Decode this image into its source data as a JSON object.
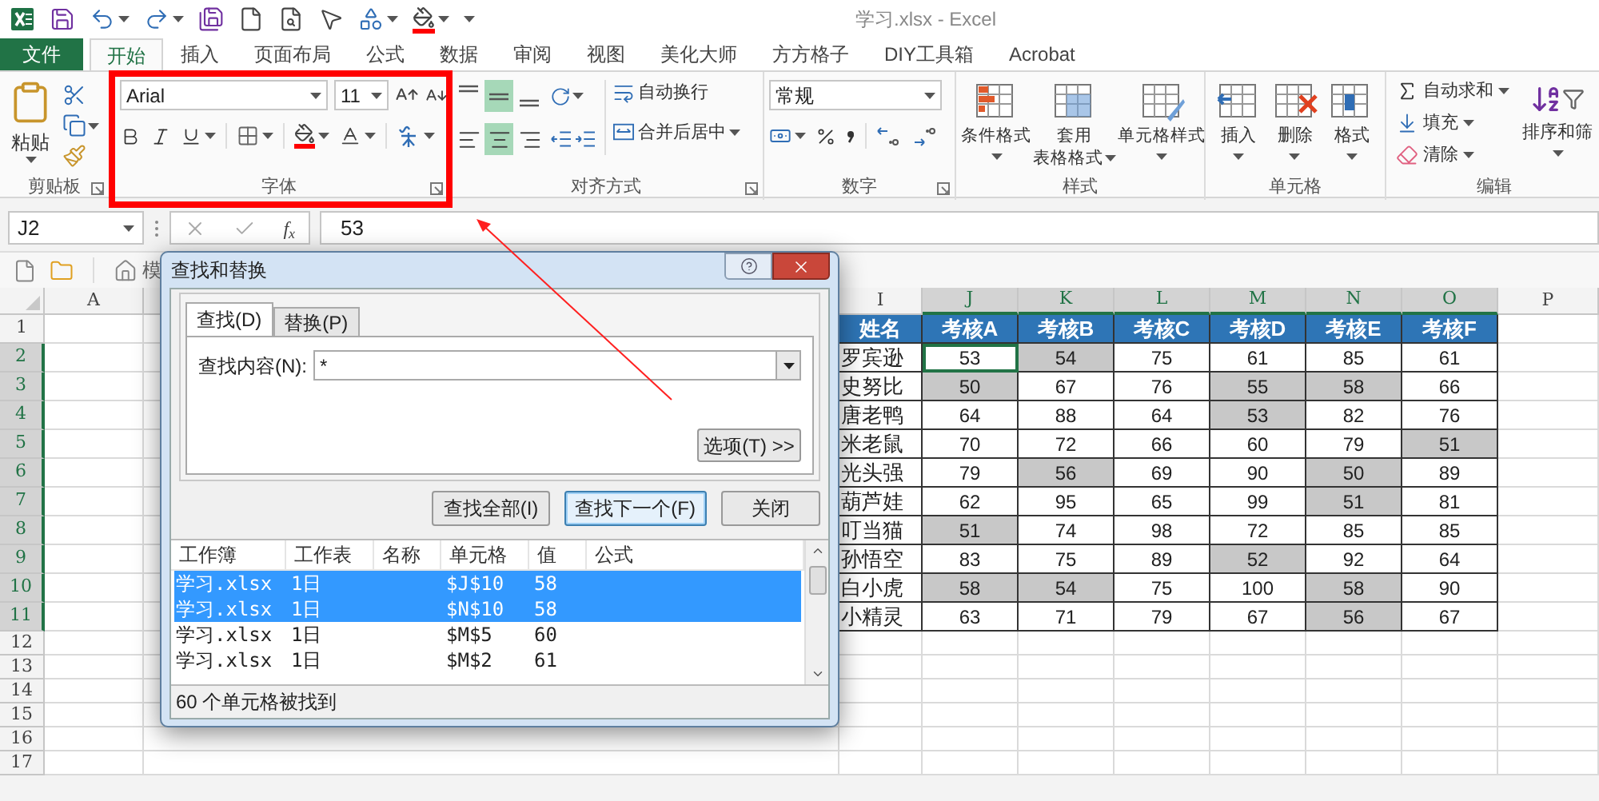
{
  "title": "学习.xlsx - Excel",
  "ribbon_tabs": [
    {
      "label": "文件",
      "kind": "file",
      "selected": false
    },
    {
      "label": "开始",
      "kind": "tab",
      "selected": true
    },
    {
      "label": "插入",
      "kind": "tab",
      "selected": false
    },
    {
      "label": "页面布局",
      "kind": "tab",
      "selected": false
    },
    {
      "label": "公式",
      "kind": "tab",
      "selected": false
    },
    {
      "label": "数据",
      "kind": "tab",
      "selected": false
    },
    {
      "label": "审阅",
      "kind": "tab",
      "selected": false
    },
    {
      "label": "视图",
      "kind": "tab",
      "selected": false
    },
    {
      "label": "美化大师",
      "kind": "tab",
      "selected": false
    },
    {
      "label": "方方格子",
      "kind": "tab",
      "selected": false
    },
    {
      "label": "DIY工具箱",
      "kind": "tab",
      "selected": false
    },
    {
      "label": "Acrobat",
      "kind": "tab",
      "selected": false
    }
  ],
  "clipboard": {
    "paste": "粘贴",
    "label": "剪贴板"
  },
  "font": {
    "name": "Arial",
    "size": "11",
    "label": "字体"
  },
  "alignment": {
    "vertical": [
      {
        "kind": "top",
        "selected": false
      },
      {
        "kind": "middle",
        "selected": true
      },
      {
        "kind": "bottom",
        "selected": false
      }
    ],
    "horizontal": [
      {
        "kind": "left",
        "selected": false
      },
      {
        "kind": "center",
        "selected": true
      },
      {
        "kind": "right",
        "selected": false
      }
    ],
    "wrap": "自动换行",
    "merge": "合并后居中",
    "label": "对齐方式"
  },
  "number": {
    "format": "常规",
    "label": "数字"
  },
  "styles": {
    "buttons": [
      {
        "lines": [
          "条件格式"
        ],
        "kind": "conditional"
      },
      {
        "lines": [
          "套用",
          "表格格式"
        ],
        "kind": "table"
      },
      {
        "lines": [
          "单元格样式"
        ],
        "kind": "cell"
      }
    ],
    "label": "样式"
  },
  "cells": {
    "buttons": [
      {
        "label": "插入",
        "kind": "insert"
      },
      {
        "label": "删除",
        "kind": "delete"
      },
      {
        "label": "格式",
        "kind": "format"
      }
    ],
    "label": "单元格"
  },
  "editing": {
    "items": [
      {
        "label": "自动求和",
        "kind": "sum"
      },
      {
        "label": "填充",
        "kind": "fill"
      },
      {
        "label": "清除",
        "kind": "clear"
      }
    ],
    "sort": "排序和筛",
    "label": "编辑"
  },
  "formula_bar": {
    "name_box": "J2",
    "function_label": "f$_{x}$",
    "value": "53"
  },
  "sheet_toolbar": {
    "template": "模"
  },
  "sheet": {
    "column_headers": [
      {
        "label": "A",
        "selected": false
      },
      {
        "label": "I",
        "selected": false
      },
      {
        "label": "J",
        "selected": true
      },
      {
        "label": "K",
        "selected": true
      },
      {
        "label": "L",
        "selected": true
      },
      {
        "label": "M",
        "selected": true
      },
      {
        "label": "N",
        "selected": true
      },
      {
        "label": "O",
        "selected": true
      },
      {
        "label": "P",
        "selected": false
      }
    ],
    "row_headers": [
      {
        "label": "1",
        "selected": false
      },
      {
        "label": "2",
        "selected": true
      },
      {
        "label": "3",
        "selected": true
      },
      {
        "label": "4",
        "selected": true
      },
      {
        "label": "5",
        "selected": true
      },
      {
        "label": "6",
        "selected": true
      },
      {
        "label": "7",
        "selected": true
      },
      {
        "label": "8",
        "selected": true
      },
      {
        "label": "9",
        "selected": true
      },
      {
        "label": "10",
        "selected": true
      },
      {
        "label": "11",
        "selected": true
      },
      {
        "label": "12",
        "selected": false
      },
      {
        "label": "13",
        "selected": false
      },
      {
        "label": "14",
        "selected": false
      },
      {
        "label": "15",
        "selected": false
      },
      {
        "label": "16",
        "selected": false
      },
      {
        "label": "17",
        "selected": false
      }
    ],
    "table": {
      "header": [
        "姓名",
        "考核A",
        "考核B",
        "考核C",
        "考核D",
        "考核E",
        "考核F"
      ],
      "rows": [
        {
          "name": "罗宾逊",
          "cells": [
            {
              "value": "53",
              "found": false,
              "active": true
            },
            {
              "value": "54",
              "found": true,
              "active": false
            },
            {
              "value": "75",
              "found": false,
              "active": false
            },
            {
              "value": "61",
              "found": false,
              "active": false
            },
            {
              "value": "85",
              "found": false,
              "active": false
            },
            {
              "value": "61",
              "found": false,
              "active": false
            }
          ]
        },
        {
          "name": "史努比",
          "cells": [
            {
              "value": "50",
              "found": true,
              "active": false
            },
            {
              "value": "67",
              "found": false,
              "active": false
            },
            {
              "value": "76",
              "found": false,
              "active": false
            },
            {
              "value": "55",
              "found": true,
              "active": false
            },
            {
              "value": "58",
              "found": true,
              "active": false
            },
            {
              "value": "66",
              "found": false,
              "active": false
            }
          ]
        },
        {
          "name": "唐老鸭",
          "cells": [
            {
              "value": "64",
              "found": false,
              "active": false
            },
            {
              "value": "88",
              "found": false,
              "active": false
            },
            {
              "value": "64",
              "found": false,
              "active": false
            },
            {
              "value": "53",
              "found": true,
              "active": false
            },
            {
              "value": "82",
              "found": false,
              "active": false
            },
            {
              "value": "76",
              "found": false,
              "active": false
            }
          ]
        },
        {
          "name": "米老鼠",
          "cells": [
            {
              "value": "70",
              "found": false,
              "active": false
            },
            {
              "value": "72",
              "found": false,
              "active": false
            },
            {
              "value": "66",
              "found": false,
              "active": false
            },
            {
              "value": "60",
              "found": false,
              "active": false
            },
            {
              "value": "79",
              "found": false,
              "active": false
            },
            {
              "value": "51",
              "found": true,
              "active": false
            }
          ]
        },
        {
          "name": "光头强",
          "cells": [
            {
              "value": "79",
              "found": false,
              "active": false
            },
            {
              "value": "56",
              "found": true,
              "active": false
            },
            {
              "value": "69",
              "found": false,
              "active": false
            },
            {
              "value": "90",
              "found": false,
              "active": false
            },
            {
              "value": "50",
              "found": true,
              "active": false
            },
            {
              "value": "89",
              "found": false,
              "active": false
            }
          ]
        },
        {
          "name": "葫芦娃",
          "cells": [
            {
              "value": "62",
              "found": false,
              "active": false
            },
            {
              "value": "95",
              "found": false,
              "active": false
            },
            {
              "value": "65",
              "found": false,
              "active": false
            },
            {
              "value": "99",
              "found": false,
              "active": false
            },
            {
              "value": "51",
              "found": true,
              "active": false
            },
            {
              "value": "81",
              "found": false,
              "active": false
            }
          ]
        },
        {
          "name": "叮当猫",
          "cells": [
            {
              "value": "51",
              "found": true,
              "active": false
            },
            {
              "value": "74",
              "found": false,
              "active": false
            },
            {
              "value": "98",
              "found": false,
              "active": false
            },
            {
              "value": "72",
              "found": false,
              "active": false
            },
            {
              "value": "85",
              "found": false,
              "active": false
            },
            {
              "value": "85",
              "found": false,
              "active": false
            }
          ]
        },
        {
          "name": "孙悟空",
          "cells": [
            {
              "value": "83",
              "found": false,
              "active": false
            },
            {
              "value": "75",
              "found": false,
              "active": false
            },
            {
              "value": "89",
              "found": false,
              "active": false
            },
            {
              "value": "52",
              "found": true,
              "active": false
            },
            {
              "value": "92",
              "found": false,
              "active": false
            },
            {
              "value": "64",
              "found": false,
              "active": false
            }
          ]
        },
        {
          "name": "白小虎",
          "cells": [
            {
              "value": "58",
              "found": true,
              "active": false
            },
            {
              "value": "54",
              "found": true,
              "active": false
            },
            {
              "value": "75",
              "found": false,
              "active": false
            },
            {
              "value": "100",
              "found": false,
              "active": false
            },
            {
              "value": "58",
              "found": true,
              "active": false
            },
            {
              "value": "90",
              "found": false,
              "active": false
            }
          ]
        },
        {
          "name": "小精灵",
          "cells": [
            {
              "value": "63",
              "found": false,
              "active": false
            },
            {
              "value": "71",
              "found": false,
              "active": false
            },
            {
              "value": "79",
              "found": false,
              "active": false
            },
            {
              "value": "67",
              "found": false,
              "active": false
            },
            {
              "value": "56",
              "found": true,
              "active": false
            },
            {
              "value": "67",
              "found": false,
              "active": false
            }
          ]
        }
      ]
    }
  },
  "dialog": {
    "title": "查找和替换",
    "tabs": [
      {
        "label": "查找(D)",
        "selected": true
      },
      {
        "label": "替换(P)",
        "selected": false
      }
    ],
    "find_label": "查找内容(N):",
    "find_value": "*",
    "options_button": "选项(T) >>",
    "buttons": [
      {
        "label": "查找全部(I)",
        "kind": "normal"
      },
      {
        "label": "查找下一个(F)",
        "kind": "default"
      },
      {
        "label": "关闭",
        "kind": "normal"
      }
    ],
    "results": {
      "columns": [
        "工作簿",
        "工作表",
        "名称",
        "单元格",
        "值",
        "公式"
      ],
      "rows": [
        {
          "workbook": "学习.xlsx",
          "sheet": "1日",
          "cell": "$J$10",
          "value": "58",
          "selected": true
        },
        {
          "workbook": "学习.xlsx",
          "sheet": "1日",
          "cell": "$N$10",
          "value": "58",
          "selected": true
        },
        {
          "workbook": "学习.xlsx",
          "sheet": "1日",
          "cell": "$M$5",
          "value": "60",
          "selected": false
        },
        {
          "workbook": "学习.xlsx",
          "sheet": "1日",
          "cell": "$M$2",
          "value": "61",
          "selected": false
        }
      ]
    },
    "status": "60 个单元格被找到"
  }
}
